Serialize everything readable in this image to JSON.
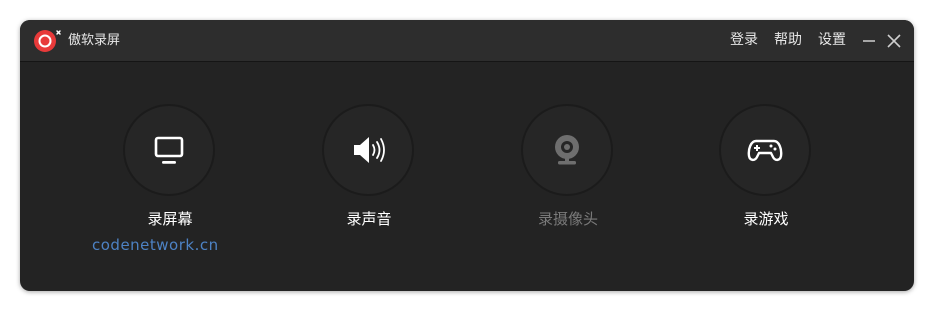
{
  "app": {
    "title": "傲软录屏",
    "accent": "#e83a3a"
  },
  "header": {
    "login": "登录",
    "help": "帮助",
    "settings": "设置"
  },
  "features": [
    {
      "label": "录屏幕",
      "icon": "monitor-icon",
      "enabled": true
    },
    {
      "label": "录声音",
      "icon": "speaker-icon",
      "enabled": true
    },
    {
      "label": "录摄像头",
      "icon": "webcam-icon",
      "enabled": false
    },
    {
      "label": "录游戏",
      "icon": "gamepad-icon",
      "enabled": true
    }
  ],
  "watermark": "codenetwork.cn"
}
